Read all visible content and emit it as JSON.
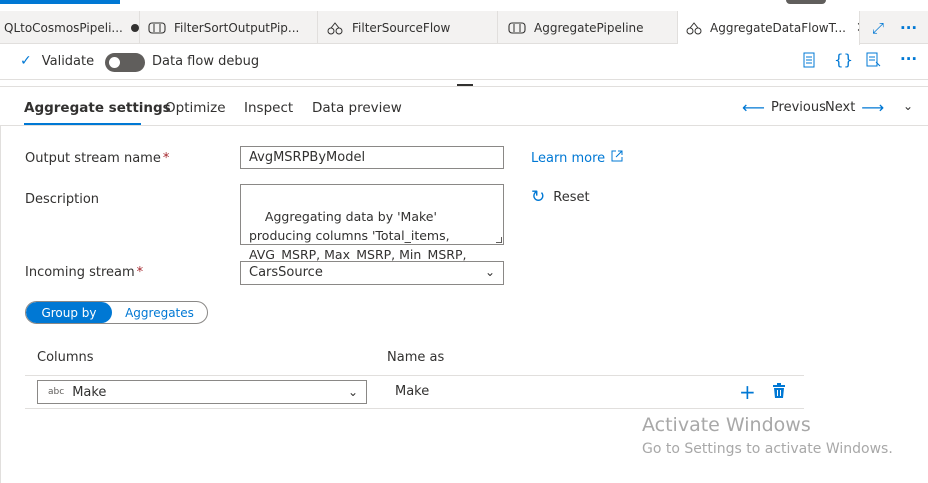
{
  "tabs": [
    {
      "label": "QLtoCosmosPipeli...",
      "icon": "pipeline-icon",
      "unsaved": true
    },
    {
      "label": "FilterSortOutputPip...",
      "icon": "pipeline-icon"
    },
    {
      "label": "FilterSourceFlow",
      "icon": "dataflow-icon"
    },
    {
      "label": "AggregatePipeline",
      "icon": "pipeline-icon"
    },
    {
      "label": "AggregateDataFlowT...",
      "icon": "dataflow-icon",
      "active": true
    }
  ],
  "toolbar": {
    "validate_label": "Validate",
    "debug_label": "Data flow debug",
    "debug_on": false
  },
  "subtabs": [
    "Aggregate settings",
    "Optimize",
    "Inspect",
    "Data preview"
  ],
  "nav": {
    "previous": "Previous",
    "next": "Next"
  },
  "form": {
    "output_stream_label": "Output stream name",
    "output_stream_value": "AvgMSRPByModel",
    "learn_more": "Learn more",
    "description_label": "Description",
    "description_value": "Aggregating data by 'Make' producing columns 'Total_items, AVG_MSRP, Max_MSRP, Min_MSRP, Sum_MSRP'",
    "reset_label": "Reset",
    "incoming_stream_label": "Incoming stream",
    "incoming_stream_value": "CarsSource",
    "required_mark": "*"
  },
  "segment": {
    "group_by": "Group by",
    "aggregates": "Aggregates",
    "selected": "group_by"
  },
  "grid": {
    "columns_header": "Columns",
    "name_as_header": "Name as",
    "rows": [
      {
        "type_badge": "abc",
        "column": "Make",
        "name_as": "Make"
      }
    ]
  },
  "watermark": {
    "title": "Activate Windows",
    "subtitle": "Go to Settings to activate Windows."
  },
  "colors": {
    "accent": "#0078d4",
    "required": "#a4262c"
  }
}
